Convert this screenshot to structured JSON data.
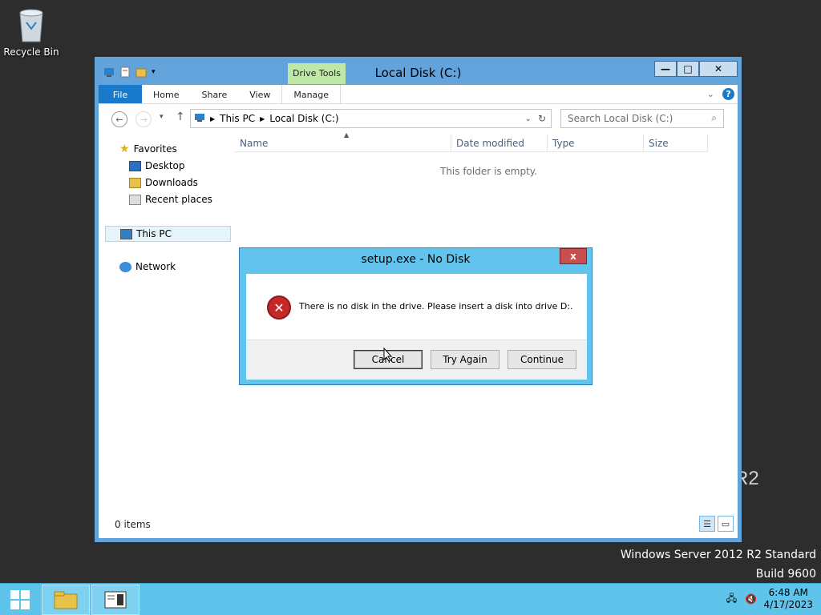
{
  "desktop": {
    "recycle_bin_label": "Recycle Bin",
    "watermark_line1": "Windows Server 2012 R2 Standard",
    "watermark_line2": "Build 9600",
    "r2_label": "R2"
  },
  "explorer": {
    "title": "Local Disk (C:)",
    "drive_tools_label": "Drive Tools",
    "tabs": [
      {
        "label": "File"
      },
      {
        "label": "Home"
      },
      {
        "label": "Share"
      },
      {
        "label": "View"
      },
      {
        "label": "Manage"
      }
    ],
    "address": {
      "crumbs": [
        "This PC",
        "Local Disk (C:)"
      ]
    },
    "search_placeholder": "Search Local Disk (C:)",
    "nav": {
      "favorites": "Favorites",
      "desktop": "Desktop",
      "downloads": "Downloads",
      "recent": "Recent places",
      "this_pc": "This PC",
      "network": "Network"
    },
    "columns": [
      "Name",
      "Date modified",
      "Type",
      "Size"
    ],
    "empty_message": "This folder is empty.",
    "status": "0 items"
  },
  "dialog": {
    "title": "setup.exe - No Disk",
    "message": "There is no disk in the drive. Please insert a disk into drive D:.",
    "buttons": {
      "cancel": "Cancel",
      "try_again": "Try Again",
      "continue": "Continue"
    },
    "close_glyph": "x"
  },
  "taskbar": {
    "time": "6:48 AM",
    "date": "4/17/2023"
  },
  "colors": {
    "titlebar": "#62a3db",
    "taskbar": "#5ec4ec",
    "dialog_frame": "#62c4ec",
    "file_tab": "#1979ca",
    "drive_tools": "#bfe7a7"
  }
}
